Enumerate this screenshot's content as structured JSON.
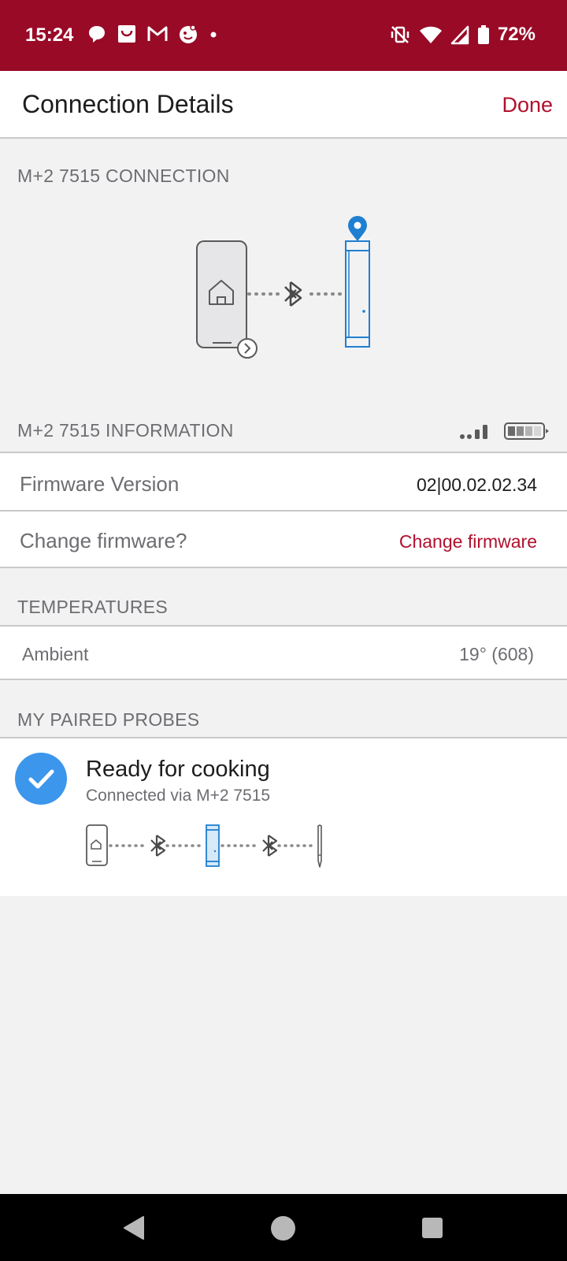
{
  "status_bar": {
    "time": "15:24",
    "battery": "72%",
    "left_icons": [
      "chat-bubble-icon",
      "shopping-bag-icon",
      "gmail-icon",
      "face-app-icon",
      "dot-icon"
    ],
    "right_icons": [
      "vibrate-off-icon",
      "wifi-icon",
      "cell-signal-icon",
      "battery-icon"
    ]
  },
  "header": {
    "title": "Connection Details",
    "done_label": "Done"
  },
  "connection_section": {
    "label": "M+2 7515 CONNECTION"
  },
  "information_section": {
    "label": "M+2 7515 INFORMATION",
    "firmware_label": "Firmware Version",
    "firmware_value": "02|00.02.02.34",
    "change_label": "Change firmware?",
    "change_link": "Change firmware"
  },
  "temperatures_section": {
    "label": "TEMPERATURES",
    "ambient_label": "Ambient",
    "ambient_value": "19° (608)"
  },
  "probes_section": {
    "label": "MY PAIRED PROBES",
    "status_title": "Ready for cooking",
    "status_subtitle": "Connected via M+2 7515"
  },
  "colors": {
    "brand": "#990a27",
    "accent_red": "#b0102d",
    "device_blue": "#1f7fd0",
    "check_blue": "#3c96ec"
  }
}
